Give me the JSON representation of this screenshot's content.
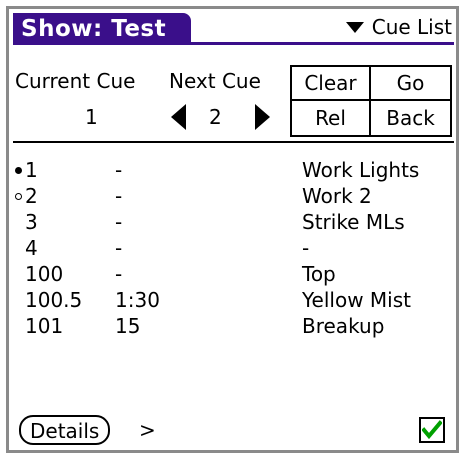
{
  "title": "Show: Test",
  "category": {
    "label": "Cue List",
    "icon": "triangle-down-icon"
  },
  "header": {
    "current_label": "Current Cue",
    "next_label": "Next Cue",
    "current_value": "1",
    "next_value": "2"
  },
  "buttons": {
    "clear": "Clear",
    "go": "Go",
    "rel": "Rel",
    "back": "Back",
    "details": "Details",
    "details_more": ">"
  },
  "cues": [
    {
      "number": "1",
      "time": "-",
      "label": "Work Lights",
      "marker": "current"
    },
    {
      "number": "2",
      "time": "-",
      "label": "Work 2",
      "marker": "next"
    },
    {
      "number": "3",
      "time": "-",
      "label": "Strike MLs",
      "marker": ""
    },
    {
      "number": "4",
      "time": "-",
      "label": "-",
      "marker": ""
    },
    {
      "number": "100",
      "time": "-",
      "label": "Top",
      "marker": ""
    },
    {
      "number": "100.5",
      "time": "1:30",
      "label": "Yellow Mist",
      "marker": ""
    },
    {
      "number": "101",
      "time": "15",
      "label": "Breakup",
      "marker": ""
    }
  ],
  "checkbox": {
    "checked": true,
    "check_color": "#00a000"
  },
  "colors": {
    "title_bar": "#3a0f8a",
    "frame": "#8a8a8a"
  }
}
